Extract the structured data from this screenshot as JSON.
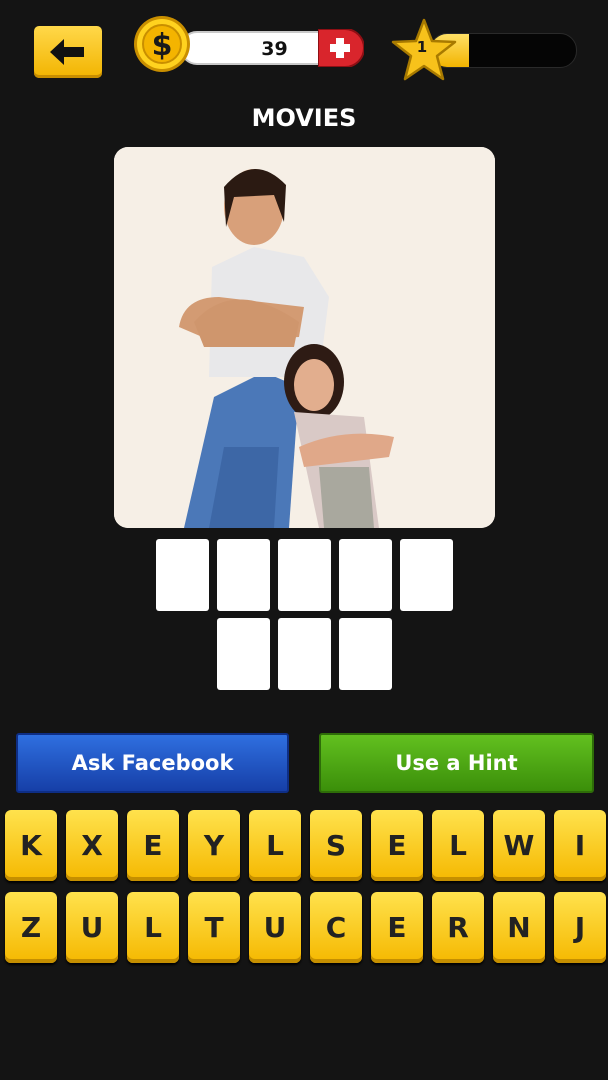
{
  "header": {
    "coins": "39",
    "level": "1",
    "level_progress": 0.26,
    "back_icon": "arrow-left-icon",
    "coin_icon": "dollar-coin-icon",
    "add_coins_icon": "plus-icon",
    "level_icon": "star-icon"
  },
  "puzzle": {
    "category": "MOVIES",
    "answer_rows": [
      5,
      3
    ]
  },
  "actions": {
    "ask_facebook": "Ask Facebook",
    "use_hint": "Use a Hint"
  },
  "keyboard": {
    "row1": [
      "K",
      "X",
      "E",
      "Y",
      "L",
      "S",
      "E",
      "L",
      "W",
      "I"
    ],
    "row2": [
      "Z",
      "U",
      "L",
      "T",
      "U",
      "C",
      "E",
      "R",
      "N",
      "J"
    ]
  },
  "colors": {
    "background": "#141414",
    "key_yellow": "#f5b800",
    "facebook_blue": "#1f55c4",
    "hint_green": "#4fa713",
    "plus_red": "#d9252c"
  }
}
